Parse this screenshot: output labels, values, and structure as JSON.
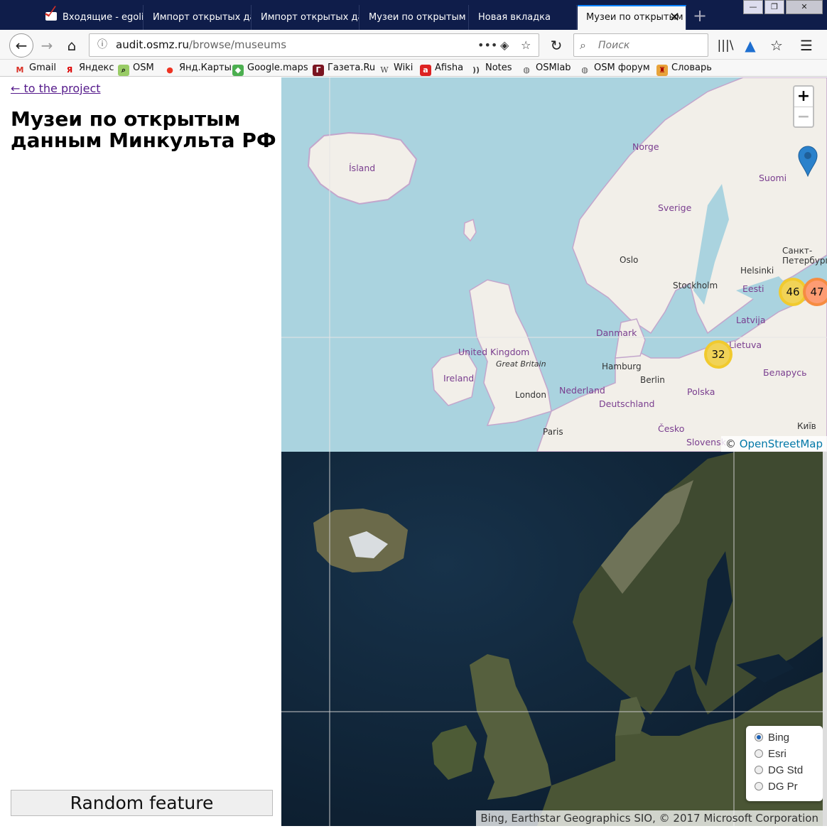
{
  "browser": {
    "tabs": [
      {
        "title": "Входящие - egolit",
        "active": false
      },
      {
        "title": "Импорт открытых дан",
        "active": false
      },
      {
        "title": "Импорт открытых дан",
        "active": false
      },
      {
        "title": "Музеи по открытым д",
        "active": false
      },
      {
        "title": "Новая вкладка",
        "active": false
      },
      {
        "title": "Музеи по открытым",
        "active": true
      }
    ],
    "new_tab": "+",
    "url_host": "audit.osmz.ru",
    "url_path": "/browse/museums",
    "search_placeholder": "Поиск",
    "bookmarks": [
      "Gmail",
      "Яндекс",
      "OSM",
      "Янд.Карты",
      "Google.maps",
      "Газета.Ru",
      "Wiki",
      "Afisha",
      "Notes",
      "OSMlab",
      "OSM форум",
      "Словарь"
    ]
  },
  "sidebar": {
    "back_link": "← to the project",
    "title": "Музеи по открытым данным Минкульта РФ",
    "random_button": "Random feature"
  },
  "map_top": {
    "zoom_in": "+",
    "zoom_out": "−",
    "labels": {
      "island": "Ísland",
      "norge": "Norge",
      "suomi": "Suomi",
      "sverige": "Sverige",
      "oslo": "Oslo",
      "spb": "Санкт-\nПетербург",
      "helsinki": "Helsinki",
      "stockholm": "Stockholm",
      "eesti": "Eesti",
      "latvija": "Latvija",
      "danmark": "Danmark",
      "lietuva": "Lietuva",
      "uk": "United Kingdom",
      "gb": "Great Britain",
      "ireland": "Ireland",
      "hamburg": "Hamburg",
      "berlin": "Berlin",
      "belarus": "Беларусь",
      "london": "London",
      "nederland": "Nederland",
      "polska": "Polska",
      "deutschland": "Deutschland",
      "kyiv": "Київ",
      "paris": "Paris",
      "cesko": "Česko",
      "slovensko": "Slovensk"
    },
    "clusters": {
      "c46": "46",
      "c47": "47",
      "c32": "32"
    },
    "attribution_prefix": "©",
    "attribution_link": "OpenStreetMap"
  },
  "map_bottom": {
    "layers": [
      {
        "label": "Bing",
        "selected": true
      },
      {
        "label": "Esri",
        "selected": false
      },
      {
        "label": "DG Std",
        "selected": false
      },
      {
        "label": "DG Pr",
        "selected": false
      }
    ],
    "attribution": "Bing, Earthstar Geographics SIO, © 2017 Microsoft Corporation"
  }
}
